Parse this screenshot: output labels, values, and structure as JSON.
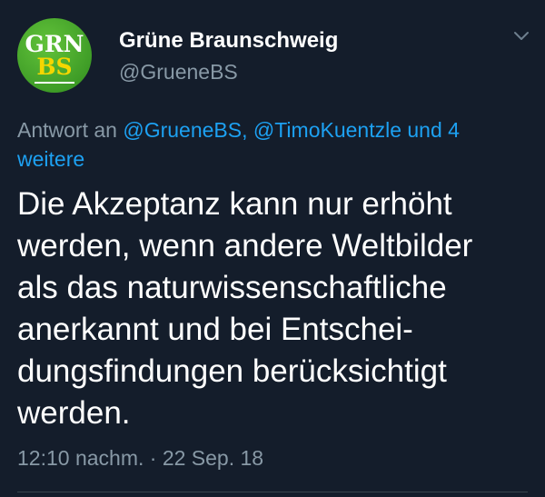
{
  "account": {
    "avatar_line1": "GRN",
    "avatar_line2": "BS",
    "display_name": "Grüne Braunschweig",
    "handle": "@GrueneBS"
  },
  "reply": {
    "prefix": "Antwort an ",
    "mention_1": "@GrueneBS,",
    "mention_2": "@TimoKuentzle und 4",
    "mention_3": "weitere"
  },
  "tweet": {
    "lines": [
      "Die Akzeptanz kann nur erhöht",
      "werden, wenn andere Weltbilder",
      "als das naturwissenschaftliche",
      "anerkannt und bei Entschei-",
      "dungsfindungen berücksichtigt",
      "werden."
    ],
    "time": "12:10 nachm.",
    "separator": " · ",
    "date": "22 Sep. 18"
  },
  "icons": {
    "more": "chevron-down-icon"
  },
  "colors": {
    "background": "#141d2b",
    "link": "#1da1f2",
    "secondary_text": "#8899a6",
    "avatar_green": "#3f9d27",
    "avatar_yellow": "#f5d600"
  }
}
